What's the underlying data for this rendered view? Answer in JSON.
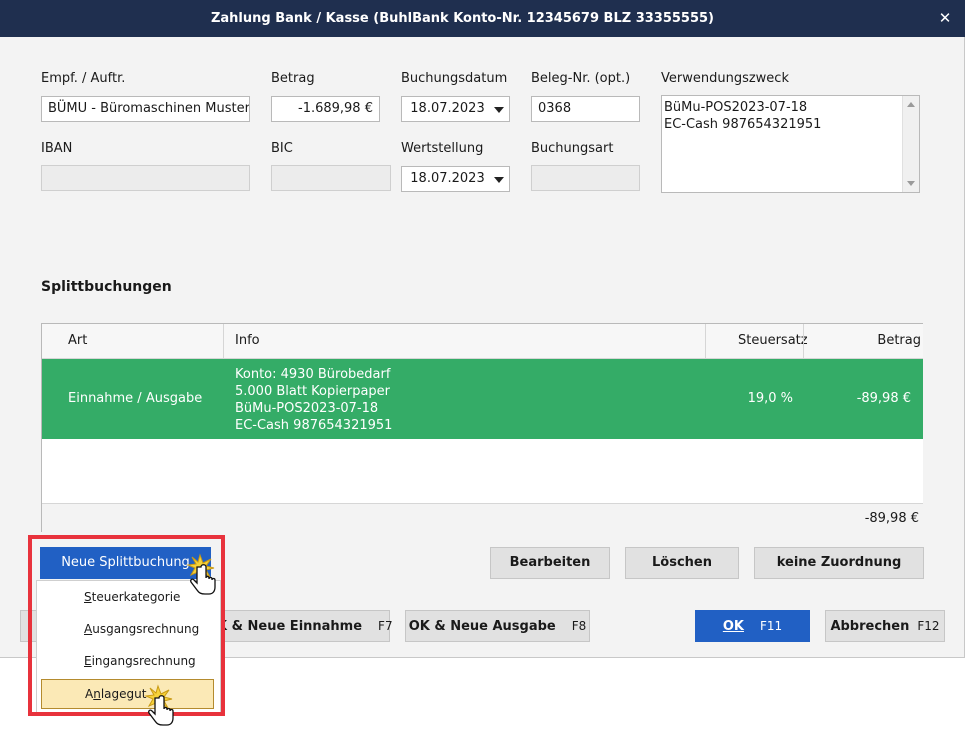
{
  "window": {
    "title": "Zahlung Bank / Kasse (BuhlBank Konto-Nr. 12345679  BLZ 33355555)",
    "close_glyph": "✕"
  },
  "form": {
    "empf_label": "Empf. / Auftr.",
    "empf_value": "BÜMU - Büromaschinen Musters",
    "betrag_label": "Betrag",
    "betrag_value": "-1.689,98 €",
    "buchungsdatum_label": "Buchungsdatum",
    "buchungsdatum_value": "18.07.2023",
    "beleg_label": "Beleg-Nr. (opt.)",
    "beleg_value": "0368",
    "verwendung_label": "Verwendungszweck",
    "verwendung_line1": "BüMu-POS2023-07-18",
    "verwendung_line2": "EC-Cash 987654321951",
    "iban_label": "IBAN",
    "iban_value": "",
    "bic_label": "BIC",
    "bic_value": "",
    "wertstellung_label": "Wertstellung",
    "wertstellung_value": "18.07.2023",
    "buchungsart_label": "Buchungsart",
    "buchungsart_value": ""
  },
  "split": {
    "heading": "Splittbuchungen",
    "columns": {
      "art": "Art",
      "info": "Info",
      "steuersatz": "Steuersatz",
      "betrag": "Betrag"
    },
    "rows": [
      {
        "art": "Einnahme / Ausgabe",
        "info1": "Konto: 4930 Bürobedarf",
        "info2": "5.000 Blatt Kopierpaper",
        "info3": "BüMu-POS2023-07-18",
        "info4": "EC-Cash 987654321951",
        "steuersatz": "19,0 %",
        "betrag": "-89,98 €"
      }
    ],
    "total": "-89,98 €"
  },
  "actions": {
    "bearbeiten": "Bearbeiten",
    "loeschen": "Löschen",
    "keine_zuordnung": "keine Zuordnung"
  },
  "menu": {
    "button": "Neue Splittbuchung",
    "items": [
      {
        "before": "",
        "underline": "S",
        "after": "teuerkategorie"
      },
      {
        "before": "",
        "underline": "A",
        "after": "usgangsrechnung"
      },
      {
        "before": "",
        "underline": "E",
        "after": "ingangsrechnung"
      },
      {
        "before": "A",
        "underline": "n",
        "after": "lagegut"
      }
    ]
  },
  "footer": {
    "ok_einnahme": "OK & Neue Einnahme",
    "ok_einnahme_key": "F7",
    "ok_ausgabe": "OK & Neue Ausgabe",
    "ok_ausgabe_key": "F8",
    "ok": "OK",
    "ok_key": "F11",
    "abbrechen": "Abbrechen",
    "abbrechen_key": "F12"
  },
  "colors": {
    "accent": "#2160c4",
    "row_selected": "#34ac67",
    "highlight_box": "#e8323c",
    "titlebar": "#1f2f4f"
  }
}
